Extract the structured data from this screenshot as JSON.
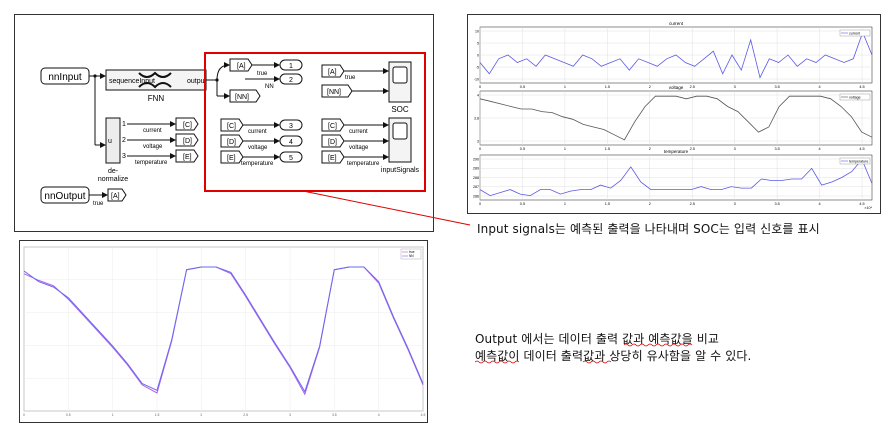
{
  "simulink": {
    "in_nnInput": "nnInput",
    "in_nnOutput": "nnOutput",
    "fnn_port_in": "sequenceInput",
    "fnn_port_out": "output",
    "fnn_label": "FNN",
    "denorm_label_1": "de-",
    "denorm_label_2": "normalize",
    "denorm_u": "u",
    "port_1": "1",
    "port_2": "2",
    "port_3": "3",
    "tag_A": "[A]",
    "tag_C": "[C]",
    "tag_D": "[D]",
    "tag_E": "[E]",
    "tag_NN": "[NN]",
    "out_1": "1",
    "out_2": "2",
    "out_3": "3",
    "out_4": "4",
    "out_5": "5",
    "lbl_true": "true",
    "lbl_NN": "NN",
    "lbl_current": "current",
    "lbl_voltage": "voltage",
    "lbl_temperature": "temperature",
    "scope_soc": "SOC",
    "scope_input_signals": "inputSignals"
  },
  "scope_panel": {
    "titles": [
      "current",
      "voltage",
      "temperature"
    ],
    "legends": [
      "current",
      "voltage",
      "temperature"
    ],
    "x_ticks": [
      "0",
      "0.5",
      "1",
      "1.5",
      "2",
      "2.5",
      "3",
      "3.5",
      "4",
      "4.5"
    ],
    "x_exponent": "×10⁴",
    "current_yticks": [
      "10",
      "5",
      "0",
      "-5",
      "-10"
    ],
    "voltage_yticks": [
      "4",
      "3.8",
      "3"
    ],
    "temperature_yticks": [
      "290",
      "289",
      "288",
      "287",
      "286"
    ],
    "line_color": "#5a5ae6",
    "voltage_color": "#555555"
  },
  "output_panel": {
    "legend": [
      "true",
      "NN"
    ],
    "x_ticks": [
      "0",
      "0.5",
      "1",
      "1.5",
      "2",
      "2.5",
      "3",
      "3.5",
      "4",
      "4.5"
    ],
    "series_colors": [
      "#b060e8",
      "#6a6af0"
    ]
  },
  "chart_data": [
    {
      "type": "line",
      "title": "current",
      "series": [
        {
          "name": "current",
          "values": [
            0,
            -3,
            1,
            2,
            0,
            1,
            -1,
            2,
            1,
            0,
            -1,
            2,
            1,
            -1,
            0,
            1,
            -2,
            1,
            0,
            -1,
            1,
            2,
            0,
            -1,
            1,
            3,
            -3,
            2,
            -2,
            6,
            -4,
            1,
            0,
            2,
            -1,
            1,
            0,
            2,
            1,
            0,
            1,
            8,
            2
          ]
        }
      ]
    },
    {
      "type": "line",
      "title": "voltage",
      "series": [
        {
          "name": "voltage",
          "values": [
            4.05,
            4.0,
            3.95,
            3.9,
            3.85,
            3.85,
            3.8,
            3.78,
            3.7,
            3.65,
            3.55,
            3.5,
            3.45,
            3.35,
            3.25,
            3.6,
            3.9,
            4.1,
            4.1,
            4.1,
            4.05,
            4.1,
            4.1,
            4.05,
            3.9,
            3.8,
            3.6,
            3.4,
            3.5,
            3.9,
            4.1,
            4.1,
            4.1,
            4.1,
            4.05,
            3.9,
            3.7,
            3.4,
            3.3
          ]
        }
      ]
    },
    {
      "type": "line",
      "title": "temperature",
      "series": [
        {
          "name": "temperature",
          "values": [
            287,
            286.6,
            286.8,
            287,
            286.7,
            286.6,
            287,
            287,
            286.7,
            286.9,
            287,
            287,
            287.3,
            287.1,
            287.6,
            288.5,
            287.5,
            287,
            287,
            287,
            287,
            287,
            287.2,
            287,
            287,
            287.2,
            287.1,
            287.1,
            287.7,
            287.6,
            287.6,
            287.7,
            287.7,
            288.4,
            287.3,
            287.5,
            287.8,
            288.2,
            289,
            287.4
          ]
        }
      ]
    },
    {
      "type": "line",
      "series": [
        {
          "name": "true",
          "values": [
            0.95,
            0.9,
            0.86,
            0.76,
            0.64,
            0.52,
            0.4,
            0.27,
            0.12,
            0.06,
            0.45,
            0.98,
            1.0,
            1.0,
            0.95,
            0.78,
            0.6,
            0.42,
            0.25,
            0.05,
            0.4,
            0.98,
            1.0,
            1.0,
            0.88,
            0.62,
            0.38,
            0.12
          ]
        },
        {
          "name": "NN",
          "values": [
            0.97,
            0.89,
            0.85,
            0.77,
            0.65,
            0.53,
            0.41,
            0.28,
            0.13,
            0.08,
            0.46,
            0.98,
            1.0,
            1.0,
            0.96,
            0.79,
            0.61,
            0.43,
            0.26,
            0.07,
            0.41,
            0.98,
            1.0,
            1.0,
            0.89,
            0.63,
            0.39,
            0.13
          ]
        }
      ]
    }
  ],
  "captions": {
    "c1": "Input signals는 예측된 출력을 나타내며 SOC는 입력 신호를 표시",
    "c2a": "Output 에서는 데이터 출력 값과 예측값을 비교",
    "c2b": "예측값이 데이터 출력값과 상당히 유사함을 알 수 있다."
  },
  "colors": {
    "highlight_box": "#e00000",
    "callout_line": "#e00000"
  }
}
